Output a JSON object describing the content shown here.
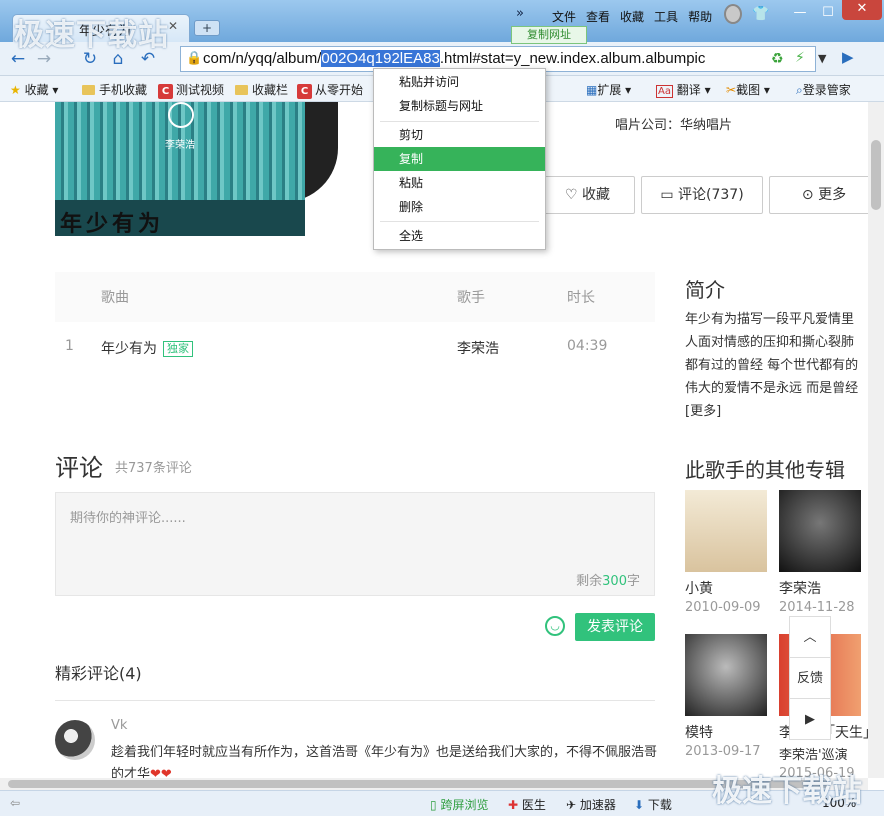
{
  "window": {
    "tab_title": "年少有为",
    "menus": [
      "文件",
      "查看",
      "收藏",
      "工具",
      "帮助"
    ],
    "more_icon": "»"
  },
  "toolbar": {
    "url_prefix": "com/n/yqq/album/",
    "url_selected": "002O4q192lEA83",
    "url_suffix": ".html#stat=y_new.index.album.albumpic",
    "copy_url_label": "复制网址"
  },
  "bookmarks": {
    "favorites": "收藏",
    "items": [
      "手机收藏",
      "测试视频",
      "收藏栏",
      "从零开始"
    ],
    "extend": "扩展",
    "translate": "翻译",
    "screenshot": "截图",
    "login": "登录管家"
  },
  "context_menu": {
    "items": [
      "粘贴并访问",
      "复制标题与网址",
      "剪切",
      "复制",
      "粘贴",
      "删除",
      "全选"
    ],
    "highlighted": "复制"
  },
  "album": {
    "cover_caption": "李荣浩",
    "cover_title": "年少有为",
    "company": "唱片公司：华纳唱片",
    "collect_label": "收藏",
    "comment_label": "评论(737)",
    "more_label": "更多"
  },
  "songs": {
    "headers": [
      "歌曲",
      "歌手",
      "时长"
    ],
    "rows": [
      {
        "index": "1",
        "title": "年少有为",
        "tag": "独家",
        "artist": "李荣浩",
        "duration": "04:39"
      }
    ]
  },
  "intro": {
    "title": "简介",
    "text": "年少有为描写一段平凡爱情里\n人面对情感的压抑和撕心裂肺\n都有过的曾经 每个世代都有的\n伟大的爱情不是永远 而是曾经\n[更多]"
  },
  "comments": {
    "title": "评论",
    "count": "共737条评论",
    "placeholder": "期待你的神评论......",
    "remain_prefix": "剩余",
    "remain_num": "300",
    "remain_suffix": "字",
    "post_label": "发表评论",
    "featured": "精彩评论(4)",
    "user": "Vk",
    "text": "趁着我们年轻时就应当有所作为，这首浩哥《年少有为》也是送给我们大家的，不得不佩服浩哥的才华"
  },
  "other_albums": {
    "title": "此歌手的其他专辑",
    "items": [
      {
        "name": "小黄",
        "date": "2010-09-09"
      },
      {
        "name": "李荣浩",
        "date": "2014-11-28"
      },
      {
        "name": "模特",
        "date": "2013-09-17"
      },
      {
        "name": "李荣浩「天生」",
        "date": "李荣浩'巡演"
      }
    ],
    "bottom_date": "2015-06-19"
  },
  "float_bar": {
    "feedback": "反馈"
  },
  "statusbar": {
    "items": [
      "跨屏浏览",
      "医生",
      "加速器",
      "下载"
    ],
    "zoom": "100%"
  },
  "watermark": "极速下载站",
  "colors": {
    "accent": "#31c27c",
    "menu_highlight": "#36b35a",
    "selection": "#3875d7"
  }
}
